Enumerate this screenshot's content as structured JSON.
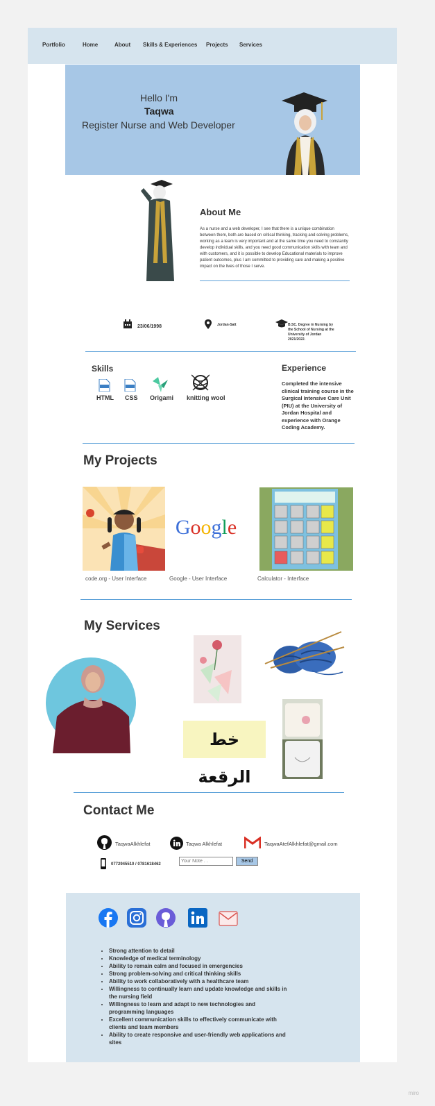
{
  "nav": {
    "brand": "Portfolio",
    "items": [
      "Home",
      "About",
      "Skills & Experiences",
      "Projects",
      "Services"
    ]
  },
  "hero": {
    "greeting": "Hello I'm",
    "name": "Taqwa",
    "role": "Register Nurse and Web Developer"
  },
  "about": {
    "title": "About Me",
    "text": "As a nurse and a web developer, I see that there is a unique combination between them, both are based on critical thinking, tracking and solving problems, working as a team is very important and at the same time you need to constantly develop individual skills, and you need good communication skills with team and with customers, and it is possible to develop Educational materials to improve patient outcomes, plus I am committed to providing care and making a positive impact on the lives of those I serve."
  },
  "info": {
    "dob": "23/06/1998",
    "location": "Jordan-Salt",
    "degree": "B.SC. Degree in Nursing by the School of Nursing at the University of Jordan 2021/2022."
  },
  "skills": {
    "title": "Skills",
    "items": [
      "HTML",
      "CSS",
      "Origami",
      "knitting wool"
    ]
  },
  "experience": {
    "title": "Experience",
    "text": "Completed the intensive clinical training course in the Surgical Intensive Care Unit (PIU) at the University of Jordan Hospital and experience with Orange Coding Academy."
  },
  "projects": {
    "title": "My Projects",
    "items": [
      {
        "caption": "code.org - User Interface"
      },
      {
        "caption": "Google - User Interface",
        "logo_text": "Google"
      },
      {
        "caption": "Calculator - Interface"
      }
    ]
  },
  "services": {
    "title": "My Services",
    "calligraphy": "خط الرقعة"
  },
  "contact": {
    "title": "Contact Me",
    "github": "TaqwaAlkhlefat",
    "linkedin": "Taqwa Alkhlefat",
    "email": "TaqwaAtefAlkhlefat@gmail.com",
    "phone": "0772945510 / 0781618462",
    "note_placeholder": "Your Note . .",
    "send_label": "Send"
  },
  "footer": {
    "bullets": [
      "Strong attention to detail",
      "Knowledge of medical terminology",
      "Ability to remain calm and focused in emergencies",
      "Strong problem-solving and critical thinking skills",
      "Ability to work collaboratively with a healthcare team",
      "Willingness to continually learn and update knowledge and skills in the nursing field",
      "Willingness to learn and adapt to new technologies and programming languages",
      "Excellent communication skills to effectively communicate with clients and team members",
      "Ability to create responsive and user-friendly web applications and sites"
    ]
  },
  "watermark": "miro",
  "colors": {
    "nav_bg": "#d6e4ee",
    "hero_bg": "#a7c7e6",
    "divider": "#5aa0d8"
  }
}
